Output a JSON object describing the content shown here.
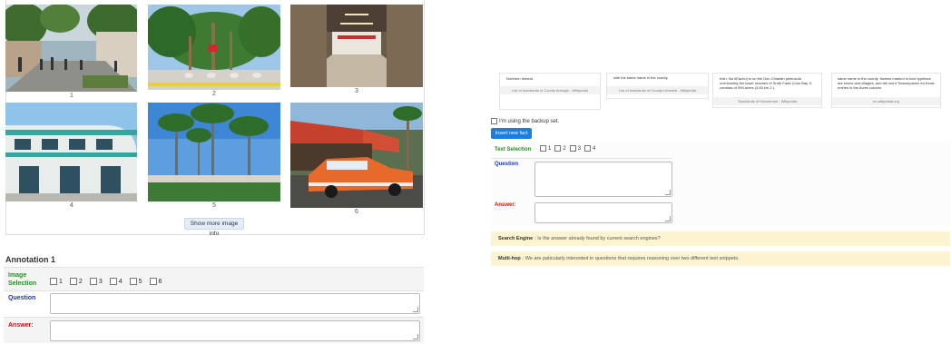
{
  "gallery": {
    "captions": [
      "1",
      "2",
      "3",
      "4",
      "5",
      "6"
    ],
    "show_more_label": "Show more image info"
  },
  "annotation": {
    "title": "Annotation 1",
    "image_selection_label": "Image Selection",
    "image_options": [
      "1",
      "2",
      "3",
      "4",
      "5",
      "6"
    ],
    "question_label": "Question",
    "answer_label": "Answer:"
  },
  "cards": [
    {
      "text": [
        "Northern Ireland."
      ],
      "footer": "List of townlands in County Armagh - Wikipedia"
    },
    {
      "text": [
        "with the same name in the county."
      ],
      "footer": "List of townlands of County Limerick - Wikipedia"
    },
    {
      "text": [
        "Irish: Na hEachú) is on the Dún Chiaráin peninsula",
        "overlooking the lower reaches of Sruth Fada Conn Bay. It",
        "consists of 999 acres (3.83 km 2 )."
      ],
      "footer": "Townlands of Kilcommon - Wikipedia"
    },
    {
      "text": [
        "same name in the county. Names marked in bold typeface",
        "are towns and villages, and the word Townsepaces for those",
        "entries in the Acres column."
      ],
      "footer": "en.wikipedia.org"
    }
  ],
  "backup_label": "I'm using the backup set.",
  "insert_button": "Insert new fact",
  "text_selection": {
    "label": "Text Selection",
    "options": [
      "1",
      "2",
      "3",
      "4"
    ]
  },
  "right_question_label": "Question",
  "right_answer_label": "Answer:",
  "notices": {
    "search_engine_title": "Search Engine",
    "search_engine_text": ": Is the answer already found by current search engines?",
    "multihop_title": "Multi-hop",
    "multihop_text": ": We are paticularly interested in questions that requires reasoning over two different text snippets."
  }
}
